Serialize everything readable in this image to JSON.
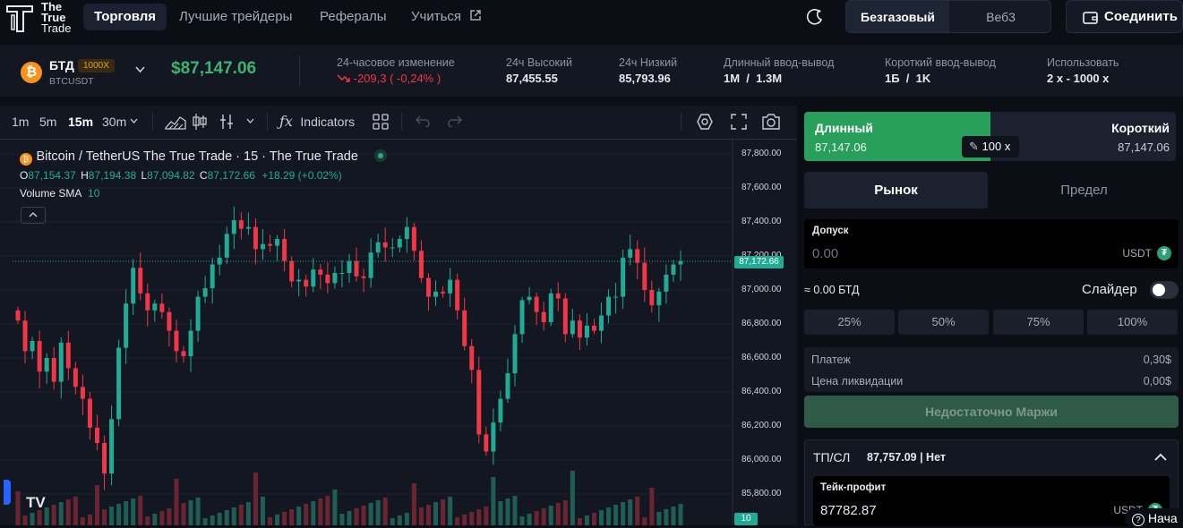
{
  "brand": {
    "line1": "The",
    "line2": "True",
    "line3": "Trade"
  },
  "nav": {
    "trade": "Торговля",
    "top_traders": "Лучшие трейдеры",
    "referrals": "Рефералы",
    "learn": "Учиться"
  },
  "header": {
    "gasless": "Безгазовый",
    "web3": "Веб3",
    "connect": "Соединить"
  },
  "ticker": {
    "symbol": "БТД",
    "leverage_badge": "1000X",
    "pair": "BTCUSDT",
    "price": "$87,147.06",
    "change_label": "24-часовое изменение",
    "change_value": "-209,3 ( -0,24% )",
    "high_label": "24ч Высокий",
    "high_value": "87,455.55",
    "low_label": "24ч Низкий",
    "low_value": "85,793.96",
    "long_io_label": "Длинный ввод-вывод",
    "long_io_value": "1M  /  1.3M",
    "short_io_label": "Короткий ввод-вывод",
    "short_io_value": "1Б  /  1K",
    "use_label": "Использовать",
    "use_value": "2 x - 1000 x"
  },
  "toolbar": {
    "tf_1m": "1m",
    "tf_5m": "5m",
    "tf_15m": "15m",
    "tf_30m": "30m",
    "indicators": "Indicators"
  },
  "legend": {
    "title": "Bitcoin / TetherUS The True Trade · 15 · The True Trade",
    "o_label": "O",
    "o": "87,154.37",
    "h_label": "H",
    "h": "87,194.38",
    "l_label": "L",
    "l": "87,094.82",
    "c_label": "C",
    "c": "87,172.66",
    "chg": "+18.29 (+0.02%)",
    "volume_label": "Volume SMA",
    "volume_value": "10"
  },
  "chart_data": {
    "type": "candlestick",
    "symbol": "BTCUSDT",
    "interval": "15",
    "y_ticks": [
      "87,800.00",
      "87,600.00",
      "87,400.00",
      "87,200.00",
      "87,000.00",
      "86,800.00",
      "86,600.00",
      "86,400.00",
      "86,200.00",
      "86,000.00",
      "85,800.00"
    ],
    "ylim": [
      85700,
      87900
    ],
    "last_price": "87,172.66",
    "volume_sma_tag": "10",
    "up_color": "#22ab94",
    "down_color": "#f23645",
    "close": [
      86820,
      86640,
      86700,
      86520,
      86600,
      86460,
      86690,
      86540,
      86430,
      86360,
      86190,
      86100,
      85920,
      86240,
      86660,
      86920,
      87130,
      86980,
      86880,
      86920,
      86870,
      86760,
      86640,
      86610,
      86760,
      86960,
      87010,
      87150,
      87190,
      87330,
      87410,
      87360,
      87370,
      87240,
      87270,
      87260,
      87300,
      87170,
      87050,
      87060,
      87020,
      87120,
      87090,
      87040,
      87100,
      87100,
      87170,
      87080,
      87070,
      87220,
      87280,
      87250,
      87250,
      87300,
      87370,
      87230,
      87070,
      86960,
      86990,
      86980,
      87060,
      86880,
      86670,
      86530,
      86150,
      86050,
      86220,
      86360,
      86510,
      86740,
      86940,
      86960,
      86870,
      86810,
      86980,
      86950,
      86740,
      86820,
      86720,
      86790,
      86760,
      86850,
      86960,
      86960,
      87190,
      87240,
      87160,
      87000,
      86910,
      86990,
      87090,
      87150,
      87170
    ]
  },
  "panel": {
    "long_label": "Длинный",
    "long_price": "87,147.06",
    "short_label": "Короткий",
    "short_price": "87,147.06",
    "leverage": "100 x",
    "market": "Рынок",
    "limit": "Предел",
    "allowance_label": "Допуск",
    "allowance_placeholder": "0.00",
    "allowance_unit": "USDT",
    "approx": "≈ 0.00 БТД",
    "slider_label": "Слайдер",
    "pct": [
      "25%",
      "50%",
      "75%",
      "100%"
    ],
    "fee_label": "Платеж",
    "fee_value": "0,30$",
    "liq_label": "Цена ликвидации",
    "liq_value": "0,00$",
    "submit": "Недостаточно Маржи",
    "tpsl_label": "ТП/СЛ",
    "tpsl_value": "87,757.09 | Нет",
    "tp_label": "Тейк-профит",
    "tp_value": "87782.87",
    "tp_unit": "USDT",
    "help": "Нача"
  },
  "colors": {
    "accent_green": "#28a05c",
    "price_green": "#3cb371",
    "down_red": "#f23645"
  }
}
